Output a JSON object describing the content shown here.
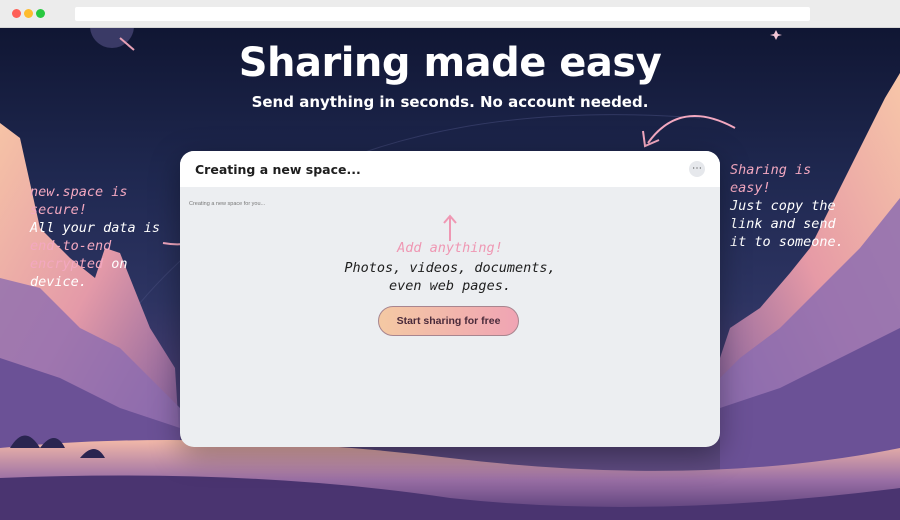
{
  "browser": {
    "window_controls": [
      "close",
      "minimize",
      "maximize"
    ],
    "address_bar_value": ""
  },
  "hero": {
    "title": "Sharing made easy",
    "subtitle": "Send anything in seconds. No account needed."
  },
  "annotations": {
    "left": {
      "highlight": "new.space is secure!",
      "line1": "All your data is ",
      "highlight2": "end-to-end encrypted",
      "line2": " on device."
    },
    "right": {
      "highlight": "Sharing is easy!",
      "body": "Just copy the link and send it to someone."
    }
  },
  "card": {
    "title": "Creating a new space...",
    "menu_icon": "ellipsis-icon",
    "loading_text": "Creating a new space for you...",
    "prompt_title": "Add anything!",
    "prompt_body_1": "Photos, videos, documents,",
    "prompt_body_2": "even web pages.",
    "cta_label": "Start sharing for free"
  },
  "colors": {
    "accent_pink": "#f3a8c0",
    "cta_gradient_start": "#f4c9a3",
    "cta_gradient_end": "#f0a4b4",
    "sky_top": "#101633"
  }
}
